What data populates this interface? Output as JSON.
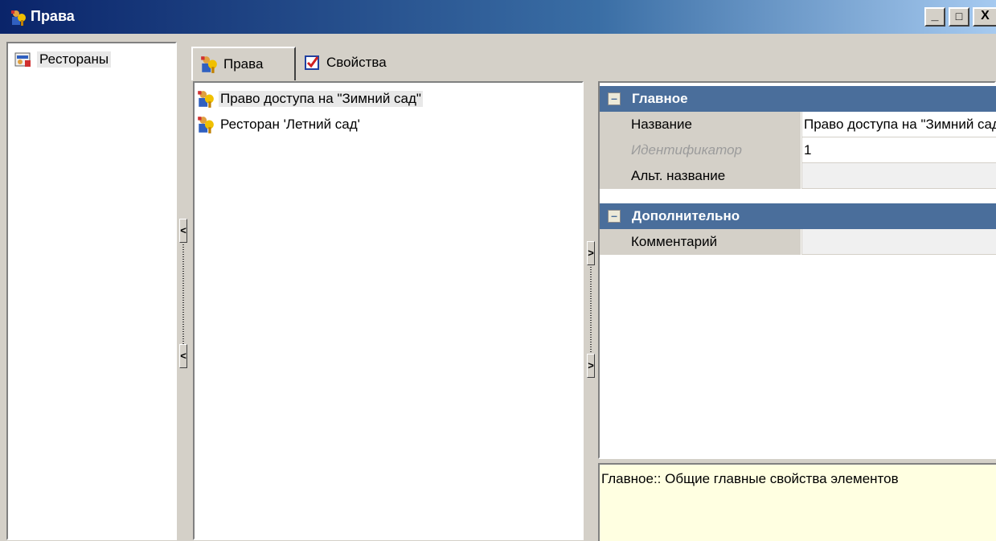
{
  "window": {
    "title": "Права",
    "minimize_label": "_",
    "maximize_label": "□",
    "close_label": "X"
  },
  "left_tree": {
    "items": [
      {
        "label": "Рестораны",
        "icon": "restaurants-icon"
      }
    ]
  },
  "splitters": {
    "left_arrow": "<",
    "right_arrow": ">"
  },
  "tabs": [
    {
      "label": "Права",
      "icon": "rights-icon",
      "active": true
    },
    {
      "label": "Свойства",
      "icon": "properties-checkbox-icon",
      "active": false
    }
  ],
  "rights_list": [
    {
      "label": "Право доступа на \"Зимний сад\"",
      "icon": "rights-icon",
      "selected": true
    },
    {
      "label": "Ресторан 'Летний сад'",
      "icon": "rights-icon",
      "selected": false
    }
  ],
  "property_grid": {
    "categories": [
      {
        "label": "Главное",
        "toggle": "–",
        "properties": [
          {
            "name": "Название",
            "value": "Право доступа на \"Зимний сад\"",
            "disabled": false
          },
          {
            "name": "Идентификатор",
            "value": "1",
            "disabled": true
          },
          {
            "name": "Альт. название",
            "value": "",
            "disabled": false
          }
        ]
      },
      {
        "label": "Дополнительно",
        "toggle": "–",
        "properties": [
          {
            "name": "Комментарий",
            "value": "",
            "disabled": false
          }
        ]
      }
    ],
    "description": "Главное:: Общие главные свойства элементов"
  },
  "colors": {
    "category_header": "#4a6e9b",
    "description_bg": "#ffffe1",
    "window_bg": "#d4d0c8"
  }
}
